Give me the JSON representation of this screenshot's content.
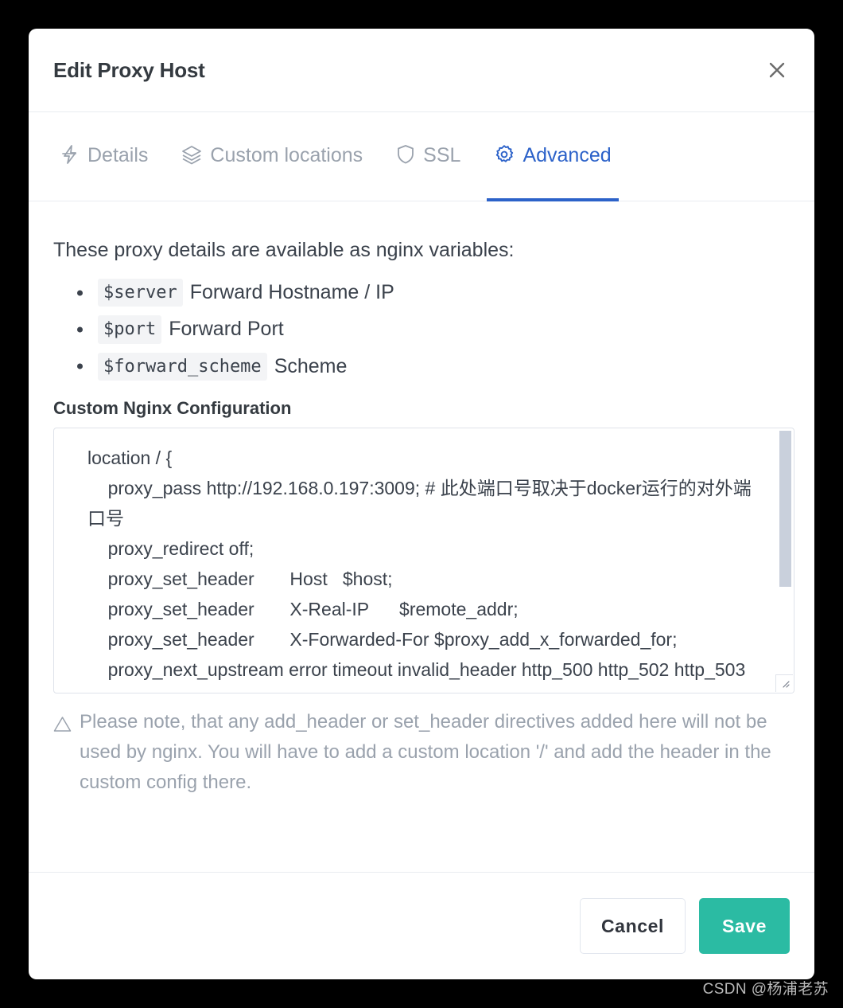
{
  "window": {
    "title": "Edit Proxy Host",
    "close_icon": "close-icon"
  },
  "tabs": [
    {
      "label": "Details",
      "icon": "bolt-icon",
      "active": false
    },
    {
      "label": "Custom locations",
      "icon": "layers-icon",
      "active": false
    },
    {
      "label": "SSL",
      "icon": "shield-icon",
      "active": false
    },
    {
      "label": "Advanced",
      "icon": "gear-icon",
      "active": true
    }
  ],
  "main": {
    "intro": "These proxy details are available as nginx variables:",
    "variables": [
      {
        "code": "$server",
        "description": "Forward Hostname / IP"
      },
      {
        "code": "$port",
        "description": "Forward Port"
      },
      {
        "code": "$forward_scheme",
        "description": "Scheme"
      }
    ],
    "config_field": {
      "label": "Custom Nginx Configuration",
      "value": "location / {\n    proxy_pass http://192.168.0.197:3009; # 此处端口号取决于docker运行的对外端口号\n    proxy_redirect off;\n    proxy_set_header       Host   $host;\n    proxy_set_header       X-Real-IP      $remote_addr;\n    proxy_set_header       X-Forwarded-For $proxy_add_x_forwarded_for;\n    proxy_next_upstream error timeout invalid_header http_500 http_502 http_503",
      "scroll_position_percent": 0
    },
    "note": "Please note, that any add_header or set_header directives added here will not be used by nginx. You will have to add a custom location '/' and add the header in the custom config there.",
    "note_icon": "warning-triangle-icon"
  },
  "footer": {
    "cancel_label": "Cancel",
    "save_label": "Save"
  },
  "watermark": "CSDN @杨浦老苏",
  "colors": {
    "accent_blue": "#2c62c9",
    "save_green": "#2bbba3",
    "title_dark": "#343a40",
    "muted_gray": "#9aa2ad",
    "page_background": "#000000"
  }
}
